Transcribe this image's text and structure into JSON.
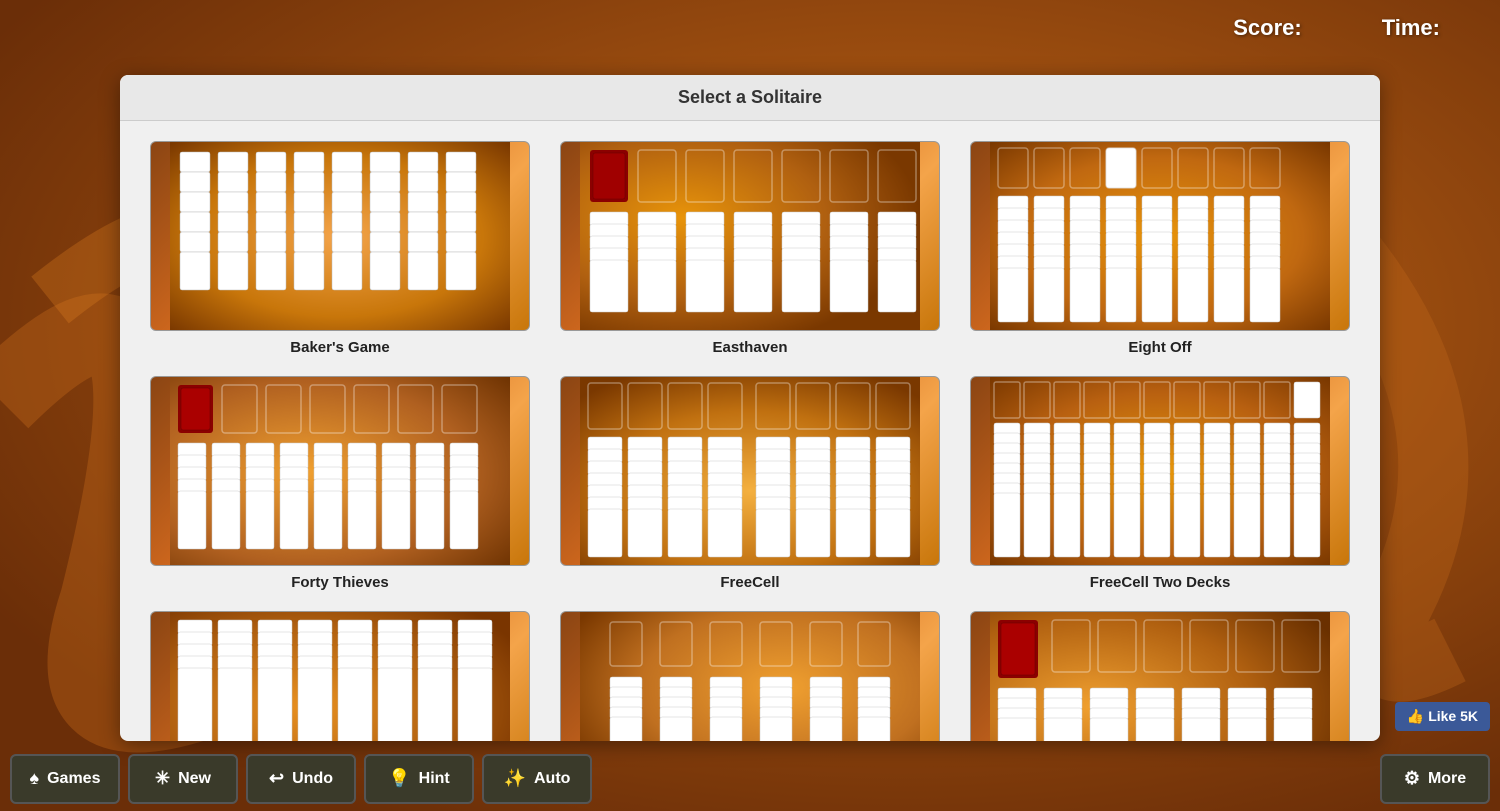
{
  "header": {
    "score_label": "Score:",
    "time_label": "Time:"
  },
  "dialog": {
    "title": "Select a Solitaire",
    "games": [
      {
        "id": "bakers-game",
        "name": "Baker's Game",
        "thumbnail_type": "bakers"
      },
      {
        "id": "easthaven",
        "name": "Easthaven",
        "thumbnail_type": "easthaven"
      },
      {
        "id": "eight-off",
        "name": "Eight Off",
        "thumbnail_type": "eight-off"
      },
      {
        "id": "forty-thieves",
        "name": "Forty Thieves",
        "thumbnail_type": "forty-thieves"
      },
      {
        "id": "freecell",
        "name": "FreeCell",
        "thumbnail_type": "freecell"
      },
      {
        "id": "freecell-two-decks",
        "name": "FreeCell Two Decks",
        "thumbnail_type": "freecell-two"
      },
      {
        "id": "game7",
        "name": "",
        "thumbnail_type": "generic"
      },
      {
        "id": "game8",
        "name": "",
        "thumbnail_type": "generic2"
      },
      {
        "id": "game9",
        "name": "",
        "thumbnail_type": "generic3"
      }
    ]
  },
  "toolbar": {
    "games_label": "Games",
    "new_label": "New",
    "undo_label": "Undo",
    "hint_label": "Hint",
    "auto_label": "Auto",
    "more_label": "More"
  },
  "facebook": {
    "like_text": "👍 Like 5K"
  },
  "colors": {
    "background_dark": "#6b2e08",
    "background_mid": "#a05010",
    "background_light": "#d4821a",
    "toolbar_bg": "#3a3a2a",
    "dialog_bg": "#f0f0f0"
  }
}
